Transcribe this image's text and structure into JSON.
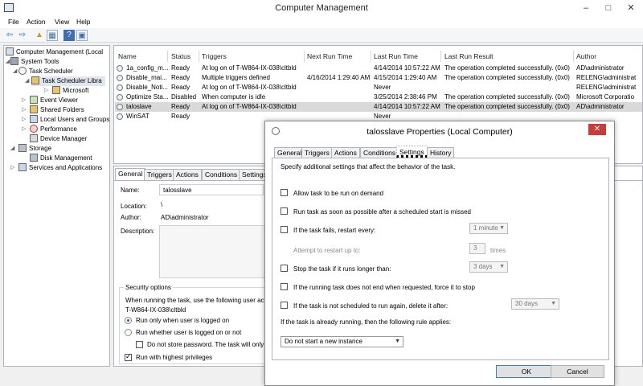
{
  "window": {
    "title": "Computer Management",
    "min": "–",
    "max": "□",
    "close": "✕"
  },
  "menu": [
    "File",
    "Action",
    "View",
    "Help"
  ],
  "toolbar": {
    "back": "⇦",
    "forward": "⇨",
    "up": "▲",
    "show_hide": "▦",
    "help": "?",
    "console": "▣"
  },
  "tree": [
    {
      "label": "Computer Management (Local",
      "indent": 0,
      "expander": ""
    },
    {
      "label": "System Tools",
      "indent": 1,
      "expander": "◢"
    },
    {
      "label": "Task Scheduler",
      "indent": 2,
      "expander": "◢"
    },
    {
      "label": "Task Scheduler Libra",
      "indent": 3,
      "expander": "◢",
      "selected": true
    },
    {
      "label": "Microsoft",
      "indent": 4,
      "expander": "▷"
    },
    {
      "label": "Event Viewer",
      "indent": 2,
      "expander": "▷"
    },
    {
      "label": "Shared Folders",
      "indent": 2,
      "expander": "▷"
    },
    {
      "label": "Local Users and Groups",
      "indent": 2,
      "expander": "▷"
    },
    {
      "label": "Performance",
      "indent": 2,
      "expander": "▷"
    },
    {
      "label": "Device Manager",
      "indent": 2,
      "expander": ""
    },
    {
      "label": "Storage",
      "indent": 1,
      "expander": "◢"
    },
    {
      "label": "Disk Management",
      "indent": 2,
      "expander": ""
    },
    {
      "label": "Services and Applications",
      "indent": 1,
      "expander": "▷"
    }
  ],
  "tasks": {
    "columns": [
      "Name",
      "Status",
      "Triggers",
      "Next Run Time",
      "Last Run Time",
      "Last Run Result",
      "Author"
    ],
    "rows": [
      [
        "1a_config_m...",
        "Ready",
        "At log on of T-W864-IX-038\\cltbld",
        "",
        "4/14/2014 10:57:22 AM",
        "The operation completed successfully. (0x0)",
        "AD\\administrator"
      ],
      [
        "Disable_mai...",
        "Ready",
        "Multiple triggers defined",
        "4/16/2014 1:29:40 AM",
        "4/15/2014 1:29:40 AM",
        "The operation completed successfully. (0x0)",
        "RELENG\\administrat"
      ],
      [
        "Disable_Noti...",
        "Ready",
        "At log on of T-W864-IX-038\\cltbld",
        "",
        "Never",
        "",
        "RELENG\\administrat"
      ],
      [
        "Optimize Sta...",
        "Disabled",
        "When computer is idle",
        "",
        "3/25/2014 2:38:46 PM",
        "The operation completed successfully. (0x0)",
        "Microsoft Corporatio"
      ],
      [
        "taloslave",
        "Ready",
        "At log on of T-W864-IX-038\\cltbld",
        "",
        "4/14/2014 10:57:22 AM",
        "The operation completed successfully. (0x0)",
        "AD\\administrator"
      ],
      [
        "WinSAT",
        "Ready",
        "",
        "",
        "Never",
        "",
        ""
      ]
    ]
  },
  "detail": {
    "tabs": [
      "General",
      "Triggers",
      "Actions",
      "Conditions",
      "Settings"
    ],
    "name_label": "Name:",
    "name_value": "talosslave",
    "location_label": "Location:",
    "location_value": "\\",
    "author_label": "Author:",
    "author_value": "AD\\administrator",
    "description_label": "Description:",
    "security_title": "Security options",
    "security_text": "When running the task, use the following user ac",
    "security_account": "T-W864-IX-038\\cltbld",
    "radio_logged_on": "Run only when user is logged on",
    "radio_whether": "Run whether user is logged on or not",
    "no_store": "Do not store password.  The task will only",
    "highest": "Run with highest privileges"
  },
  "dialog": {
    "title": "talosslave Properties (Local Computer)",
    "close": "✕",
    "tabs": [
      "General",
      "Triggers",
      "Actions",
      "Conditions",
      "Settings",
      "History"
    ],
    "intro": "Specify additional settings that affect the behavior of the task.",
    "opt_demand": "Allow task to be run on demand",
    "opt_missed": "Run task as soon as possible after a scheduled start is missed",
    "opt_fails": "If the task fails, restart every:",
    "fails_interval": "1 minute",
    "attempt_label": "Attempt to restart up to:",
    "attempt_value": "3",
    "attempt_unit": "times",
    "opt_stop": "Stop the task if it runs longer than:",
    "stop_value": "3 days",
    "opt_force": "If the running task does not end when requested, force it to stop",
    "opt_delete": "If the task is not scheduled to run again, delete it after:",
    "delete_value": "30 days",
    "rule_label": "If the task is already running, then the following rule applies:",
    "rule_value": "Do not start a new instance",
    "ok": "OK",
    "cancel": "Cancel"
  }
}
